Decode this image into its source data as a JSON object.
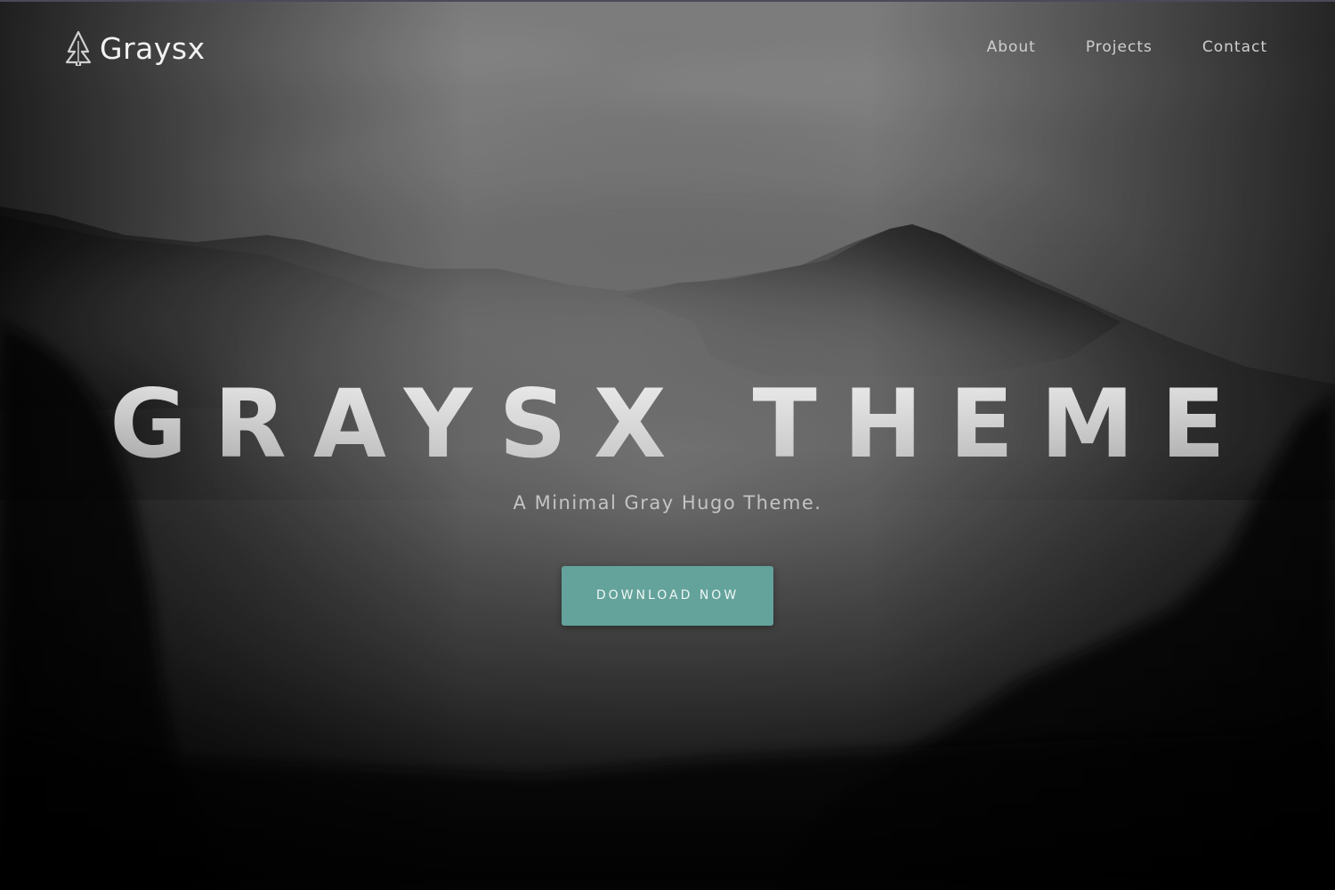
{
  "site": {
    "brand_name": "Graysx",
    "logo_icon": "tree-icon"
  },
  "nav": {
    "items": [
      {
        "label": "About"
      },
      {
        "label": "Projects"
      },
      {
        "label": "Contact"
      }
    ]
  },
  "hero": {
    "title": "GRAYSX THEME",
    "subtitle": "A Minimal Gray Hugo Theme.",
    "cta_label": "DOWNLOAD NOW",
    "background_image": "foggy-mountain-forest-grayscale"
  },
  "colors": {
    "accent": "#64a39b",
    "text_light": "#f2f2f2",
    "nav_text": "#cfcfcf"
  }
}
